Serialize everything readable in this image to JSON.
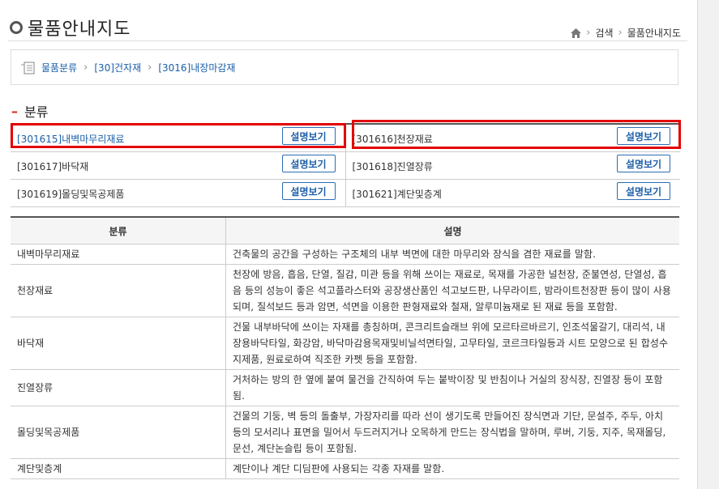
{
  "header": {
    "title": "물품안내지도",
    "crumbs": [
      "검색",
      "물품안내지도"
    ]
  },
  "breadcrumb": [
    "물품분류",
    "[30]건자재",
    "[3016]내장마감재"
  ],
  "section": {
    "title": "분류"
  },
  "categories": [
    {
      "label": "[301615]내벽마무리재료",
      "button": "설명보기"
    },
    {
      "label": "[301616]천장재료",
      "button": "설명보기"
    },
    {
      "label": "[301617]바닥재",
      "button": "설명보기"
    },
    {
      "label": "[301618]진열장류",
      "button": "설명보기"
    },
    {
      "label": "[301619]몰딩및목공제품",
      "button": "설명보기"
    },
    {
      "label": "[301621]계단및층계",
      "button": "설명보기"
    }
  ],
  "desc_table": {
    "headers": [
      "분류",
      "설명"
    ],
    "rows": [
      {
        "name": "내벽마무리재료",
        "desc": "건축물의 공간을 구성하는 구조체의 내부 벽면에 대한 마무리와 장식을 겸한 재료를 말함."
      },
      {
        "name": "천장재료",
        "desc": "천장에 방음, 흡음, 단열, 질감, 미관 등을 위해 쓰이는 재료로, 목재를 가공한 널천장, 준불연성, 단열성, 흡음 등의 성능이 좋은 석고플라스터와 공장생산품인 석고보드판, 나무라이트, 밤라이트천장판 등이 많이 사용되며, 질석보드 등과 암면, 석면을 이용한 판형재료와 철재, 알루미늄재로 된 재료 등을 포함함."
      },
      {
        "name": "바닥재",
        "desc": "건물 내부바닥에 쓰이는 자재를 총칭하며, 콘크리트슬래브 위에 모르타르바르기, 인조석물갈기, 대리석, 내장용바닥타일, 화강암, 바닥마감용목재및비닐석면타일, 고무타일, 코르크타일등과 시트 모양으로 된 합성수지제품, 원료로하여 직조한 카펫 등을 포함함."
      },
      {
        "name": "진열장류",
        "desc": "거처하는 방의 한 옆에 붙여 물건을 간직하여 두는 붙박이장 및 반침이나 거실의 장식장, 진열장 등이 포함됨."
      },
      {
        "name": "몰딩및목공제품",
        "desc": "건물의 기둥, 벽 등의 돌출부, 가장자리를 따라 선이 생기도록 만들어진 장식면과 기단, 문설주, 주두, 아치 등의 모서리나 표면을 밀어서 두드러지거나 오목하게 만드는 장식법을 말하며, 루버, 기둥, 지주, 목재몰딩, 문선, 계단논슬립 등이 포함됨."
      },
      {
        "name": "계단및층계",
        "desc": "계단이나 계단 디딤판에 사용되는 각종 자재를 말함."
      }
    ]
  }
}
